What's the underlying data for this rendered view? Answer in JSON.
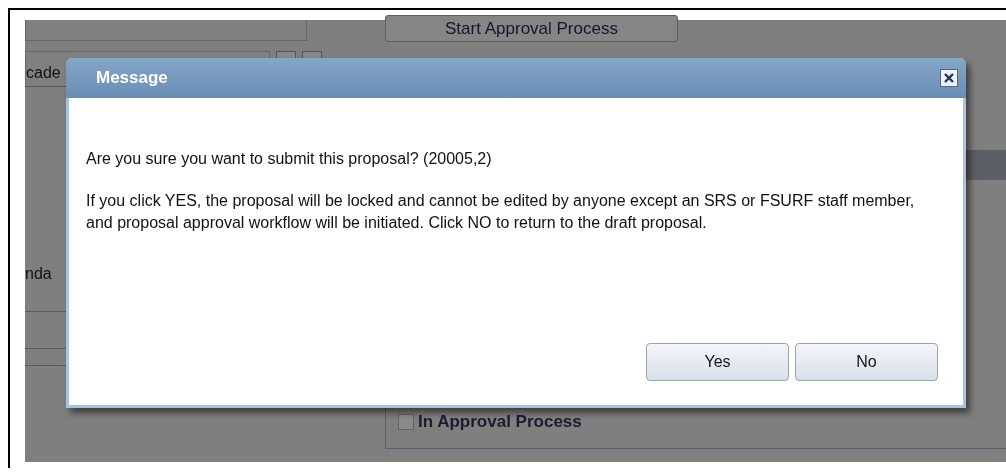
{
  "background": {
    "start_button": "Start Approval Process",
    "dropdown_text": "cade",
    "side_label": "nda",
    "checkbox": {
      "label": "In Approval Process",
      "checked": false
    }
  },
  "dialog": {
    "title": "Message",
    "paragraphs": [
      "Are you sure you want to submit this proposal? (20005,2)",
      "If you click YES, the proposal will be locked and cannot be edited by anyone except an SRS or FSURF staff member, and proposal approval workflow will be initiated. Click NO to return to the draft proposal."
    ],
    "buttons": [
      "Yes",
      "No"
    ]
  }
}
